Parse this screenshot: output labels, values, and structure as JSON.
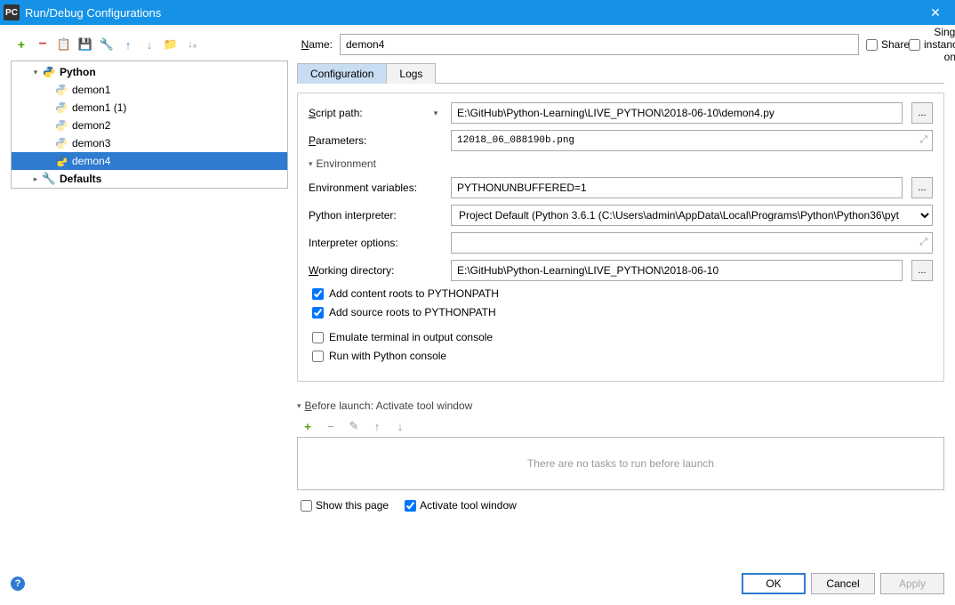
{
  "window": {
    "title": "Run/Debug Configurations",
    "icon": "PC"
  },
  "name_label": "Name:",
  "name_value": "demon4",
  "share_label": "Share",
  "single_instance_label": "Single instance only",
  "tree": {
    "python_label": "Python",
    "items": [
      {
        "label": "demon1"
      },
      {
        "label": "demon1 (1)"
      },
      {
        "label": "demon2"
      },
      {
        "label": "demon3"
      },
      {
        "label": "demon4"
      }
    ],
    "defaults_label": "Defaults"
  },
  "tabs": {
    "configuration": "Configuration",
    "logs": "Logs"
  },
  "form": {
    "script_path_label": "Script path:",
    "script_path_value": "E:\\GitHub\\Python-Learning\\LIVE_PYTHON\\2018-06-10\\demon4.py",
    "parameters_label": "Parameters:",
    "parameters_value": "12018_06_088190b.png",
    "environment_section": "Environment",
    "env_vars_label": "Environment variables:",
    "env_vars_value": "PYTHONUNBUFFERED=1",
    "interpreter_label": "Python interpreter:",
    "interpreter_value": "Project Default (Python 3.6.1 (C:\\Users\\admin\\AppData\\Local\\Programs\\Python\\Python36\\pyt",
    "interpreter_options_label": "Interpreter options:",
    "interpreter_options_value": "",
    "working_dir_label": "Working directory:",
    "working_dir_value": "E:\\GitHub\\Python-Learning\\LIVE_PYTHON\\2018-06-10",
    "add_content_roots": "Add content roots to PYTHONPATH",
    "add_source_roots": "Add source roots to PYTHONPATH",
    "emulate_terminal": "Emulate terminal in output console",
    "run_python_console": "Run with Python console"
  },
  "before_launch": {
    "header": "Before launch: Activate tool window",
    "empty_text": "There are no tasks to run before launch",
    "show_this_page": "Show this page",
    "activate_tool_window": "Activate tool window"
  },
  "footer": {
    "ok": "OK",
    "cancel": "Cancel",
    "apply": "Apply"
  }
}
